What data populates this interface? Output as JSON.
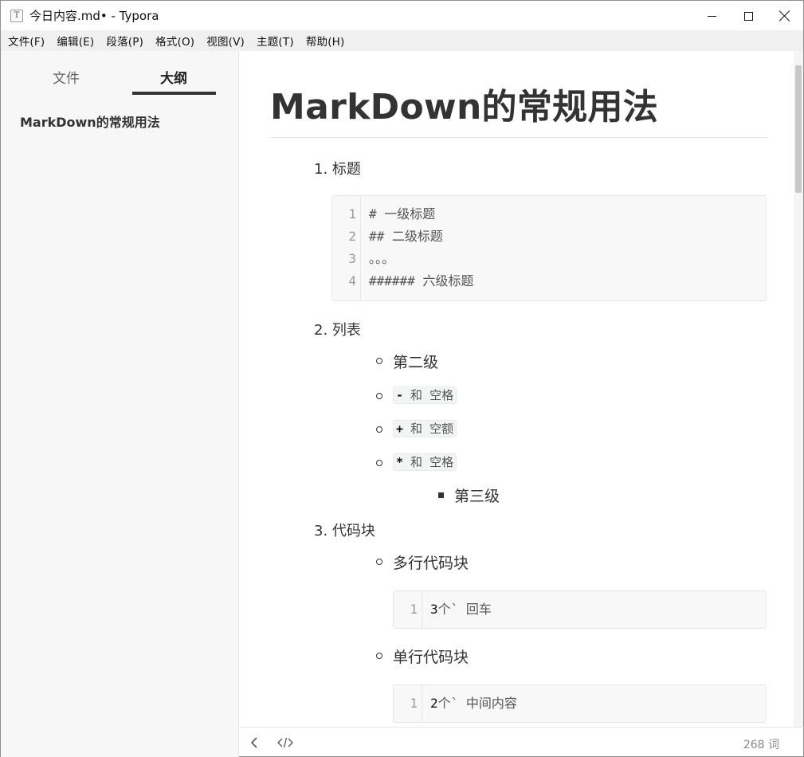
{
  "window": {
    "title": "今日内容.md• - Typora",
    "app_icon": "T"
  },
  "menu": [
    "文件(F)",
    "编辑(E)",
    "段落(P)",
    "格式(O)",
    "视图(V)",
    "主题(T)",
    "帮助(H)"
  ],
  "sidebar": {
    "tabs": [
      "文件",
      "大纲"
    ],
    "active_tab": "大纲",
    "outline": [
      "MarkDown的常规用法"
    ]
  },
  "doc": {
    "title": "MarkDown的常规用法",
    "sections": [
      {
        "label": "1. 标题",
        "code": [
          {
            "n": "1",
            "text": "# 一级标题"
          },
          {
            "n": "2",
            "text": "## 二级标题"
          },
          {
            "n": "3",
            "text": "。。。"
          },
          {
            "n": "4",
            "text": "###### 六级标题"
          }
        ]
      },
      {
        "label": "2. 列表",
        "items": [
          {
            "text": "第二级"
          },
          {
            "sym": "-",
            "text": " 和 空格"
          },
          {
            "sym": "+",
            "text": " 和 空额"
          },
          {
            "sym": "*",
            "text": " 和 空格"
          }
        ],
        "subitems": [
          "第三级"
        ]
      },
      {
        "label": "3. 代码块",
        "items": [
          {
            "text": "多行代码块",
            "code": {
              "n": "1",
              "lead": "3",
              "text": "个` 回车"
            }
          },
          {
            "text": "单行代码块",
            "code": {
              "n": "1",
              "lead": "2",
              "text": "个` 中间内容"
            }
          }
        ]
      }
    ]
  },
  "footer": {
    "word_count": "268 词",
    "back_icon": "chevron-left-icon",
    "source_icon": "code-icon"
  }
}
